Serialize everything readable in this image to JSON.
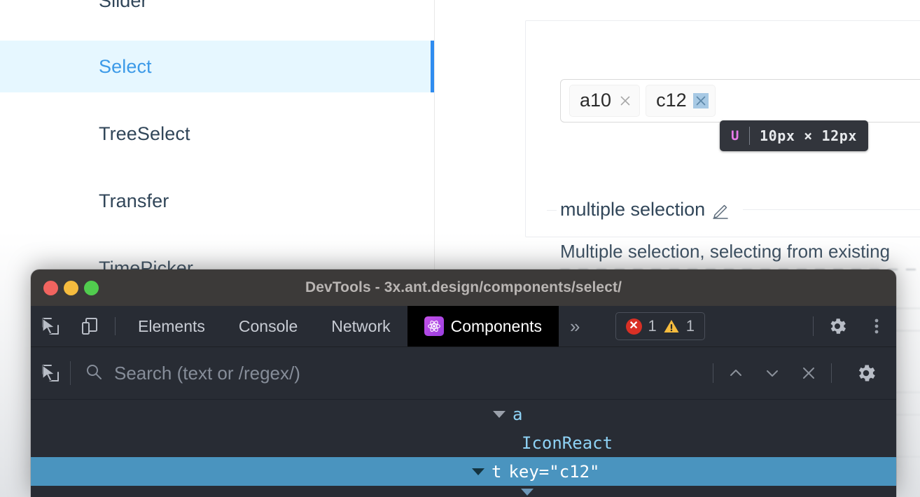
{
  "page": {
    "sidebar": {
      "items": [
        {
          "label": "Slider",
          "active": false
        },
        {
          "label": "Select",
          "active": true
        },
        {
          "label": "TreeSelect",
          "active": false
        },
        {
          "label": "Transfer",
          "active": false
        },
        {
          "label": "TimePicker",
          "active": false
        }
      ]
    },
    "demo": {
      "select": {
        "tags": [
          {
            "label": "a10",
            "close_icon": "close-icon",
            "highlighted": false
          },
          {
            "label": "c12",
            "close_icon": "close-icon",
            "highlighted": true
          }
        ]
      },
      "inspector_tooltip": {
        "tag_name": "U",
        "dimensions": "10px × 12px"
      },
      "section": {
        "title": "multiple selection",
        "edit_icon": "pencil-icon",
        "description": "Multiple selection, selecting from existing"
      }
    }
  },
  "devtools": {
    "window_title": "DevTools - 3x.ant.design/components/select/",
    "traffic_lights": {
      "close": "close-window-button",
      "minimize": "minimize-window-button",
      "maximize": "maximize-window-button"
    },
    "toolbar": {
      "inspect_icon": "inspect-element-icon",
      "device_icon": "device-toolbar-icon",
      "tabs": [
        {
          "label": "Elements",
          "active": false
        },
        {
          "label": "Console",
          "active": false
        },
        {
          "label": "Network",
          "active": false
        },
        {
          "label": "Components",
          "active": true,
          "icon": "react-logo-icon"
        }
      ],
      "more_tabs": "»",
      "issues": {
        "error_icon": "error-icon",
        "error_count": "1",
        "warning_icon": "warning-icon",
        "warning_count": "1"
      },
      "settings_icon": "gear-icon",
      "menu_icon": "kebab-menu-icon"
    },
    "search": {
      "inspect_icon": "inspect-element-icon",
      "search_icon": "search-icon",
      "placeholder": "Search (text or /regex/)",
      "value": "",
      "prev_icon": "chevron-up-icon",
      "next_icon": "chevron-down-icon",
      "clear_icon": "close-icon",
      "settings_icon": "gear-icon"
    },
    "tree": {
      "rows": [
        {
          "indent": 3,
          "caret": true,
          "name": "a",
          "attr": "",
          "selected": false
        },
        {
          "indent": 4,
          "caret": false,
          "name": "IconReact",
          "attr": "",
          "selected": false
        },
        {
          "indent": 2,
          "caret": true,
          "name": "t",
          "attr": "key=\"c12\"",
          "selected": true
        }
      ]
    }
  },
  "colors": {
    "nav_active_bg": "#e6f7ff",
    "nav_active_text": "#3c9ae8",
    "nav_active_bar": "#2f8cf0",
    "devtools_titlebar": "#3c3a39",
    "devtools_panel": "#282c34",
    "tree_selected": "#4a94bf",
    "tooltip_bg": "#32353c",
    "tooltip_tag": "#e87ae8",
    "error_red": "#d93025",
    "warning_yellow": "#f6bc3e",
    "react_purple": "#9a3fe0"
  }
}
